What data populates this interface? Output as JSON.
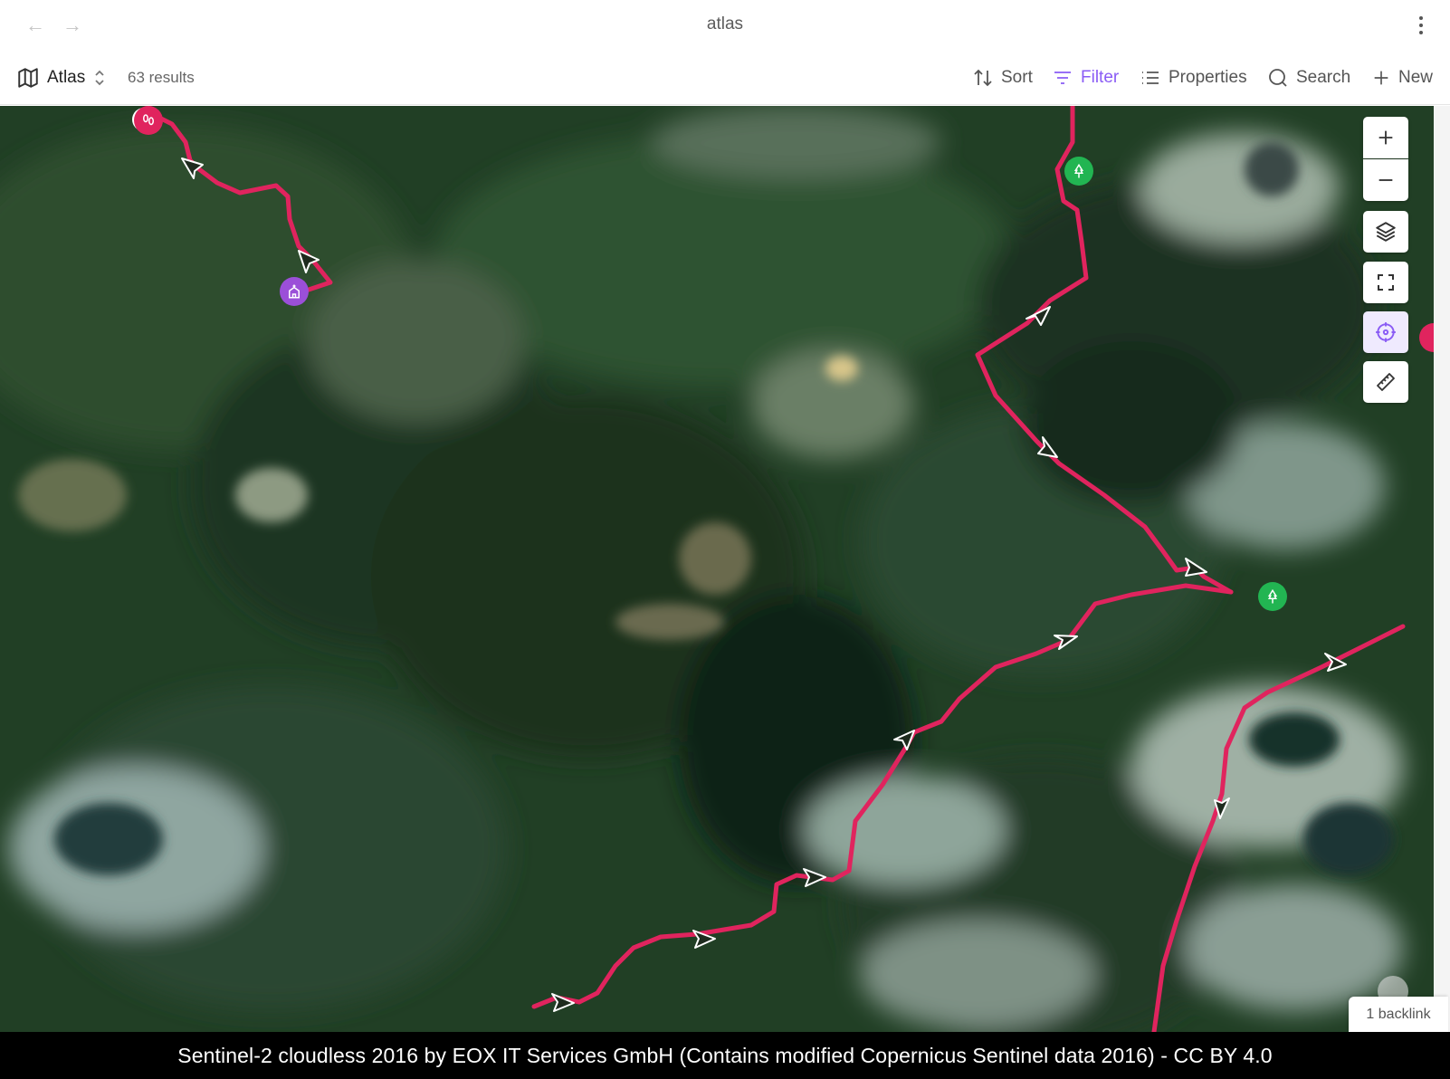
{
  "header": {
    "title": "atlas",
    "back_icon": "arrow-left-icon",
    "forward_icon": "arrow-right-icon",
    "more_icon": "more-vertical-icon"
  },
  "toolbar": {
    "view_name": "Atlas",
    "view_icon": "map-icon",
    "results": "63 results",
    "sort_label": "Sort",
    "filter_label": "Filter",
    "properties_label": "Properties",
    "search_label": "Search",
    "new_label": "New"
  },
  "map": {
    "attribution": "Sentinel-2 cloudless 2016 by EOX IT Services GmbH (Contains modified Copernicus Sentinel data 2016) - CC BY 4.0",
    "backlink": "1 backlink",
    "controls": [
      "zoom-in-icon",
      "zoom-out-icon",
      "layers-icon",
      "fullscreen-icon",
      "locate-icon",
      "ruler-icon"
    ],
    "route_color": "#e0245e",
    "markers": [
      {
        "type": "footprints-icon",
        "color": "#e0245e"
      },
      {
        "type": "church-icon",
        "color": "#9b4fd8"
      },
      {
        "type": "tree-icon",
        "color": "#22b552"
      },
      {
        "type": "tree-icon",
        "color": "#22b552"
      }
    ]
  },
  "colors": {
    "accent": "#8a5cf5",
    "route": "#e0245e"
  }
}
